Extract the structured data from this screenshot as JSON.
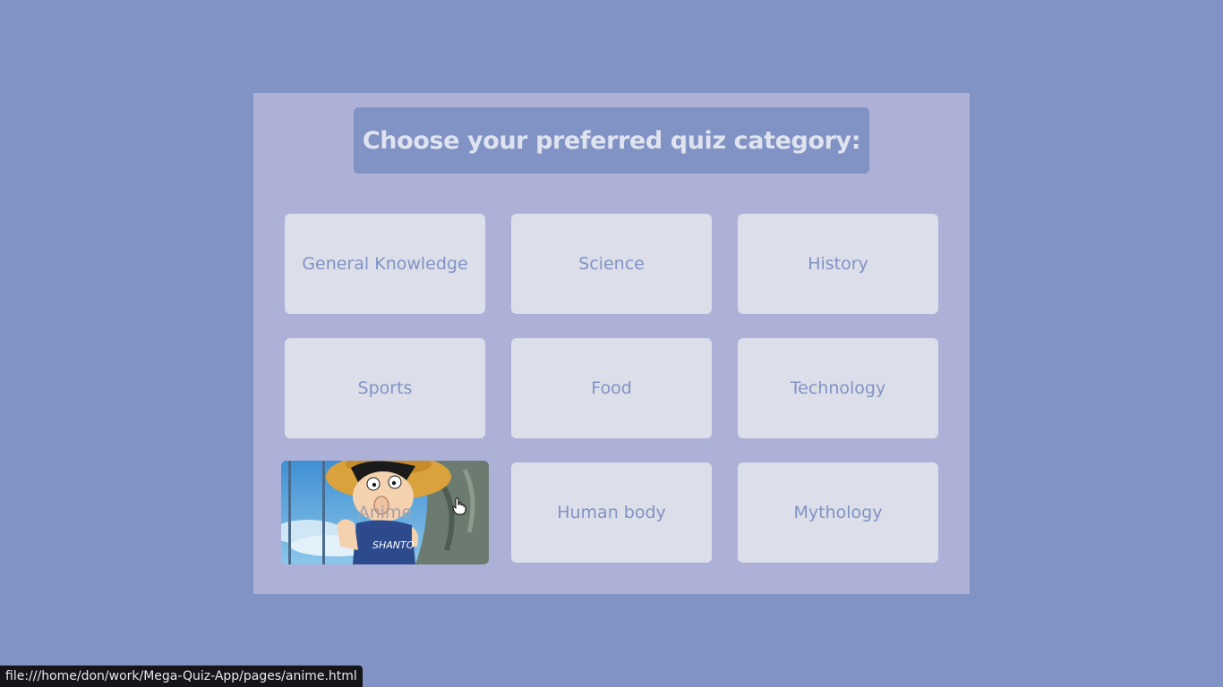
{
  "heading": "Choose your preferred quiz category:",
  "categories": [
    {
      "label": "General Knowledge"
    },
    {
      "label": "Science"
    },
    {
      "label": "History"
    },
    {
      "label": "Sports"
    },
    {
      "label": "Food"
    },
    {
      "label": "Technology"
    },
    {
      "label": "Anime",
      "hovered": true,
      "image_icon": "anime-character-image"
    },
    {
      "label": "Human body"
    },
    {
      "label": "Mythology"
    }
  ],
  "status_url": "file:///home/don/work/Mega-Quiz-App/pages/anime.html",
  "colors": {
    "background": "#8193c4",
    "panel": "#adb1d7",
    "card": "#dcdfe9",
    "card_text": "#8193c4",
    "heading_text": "#dfe3ef"
  },
  "cursor_icon": "hand-pointer-icon"
}
